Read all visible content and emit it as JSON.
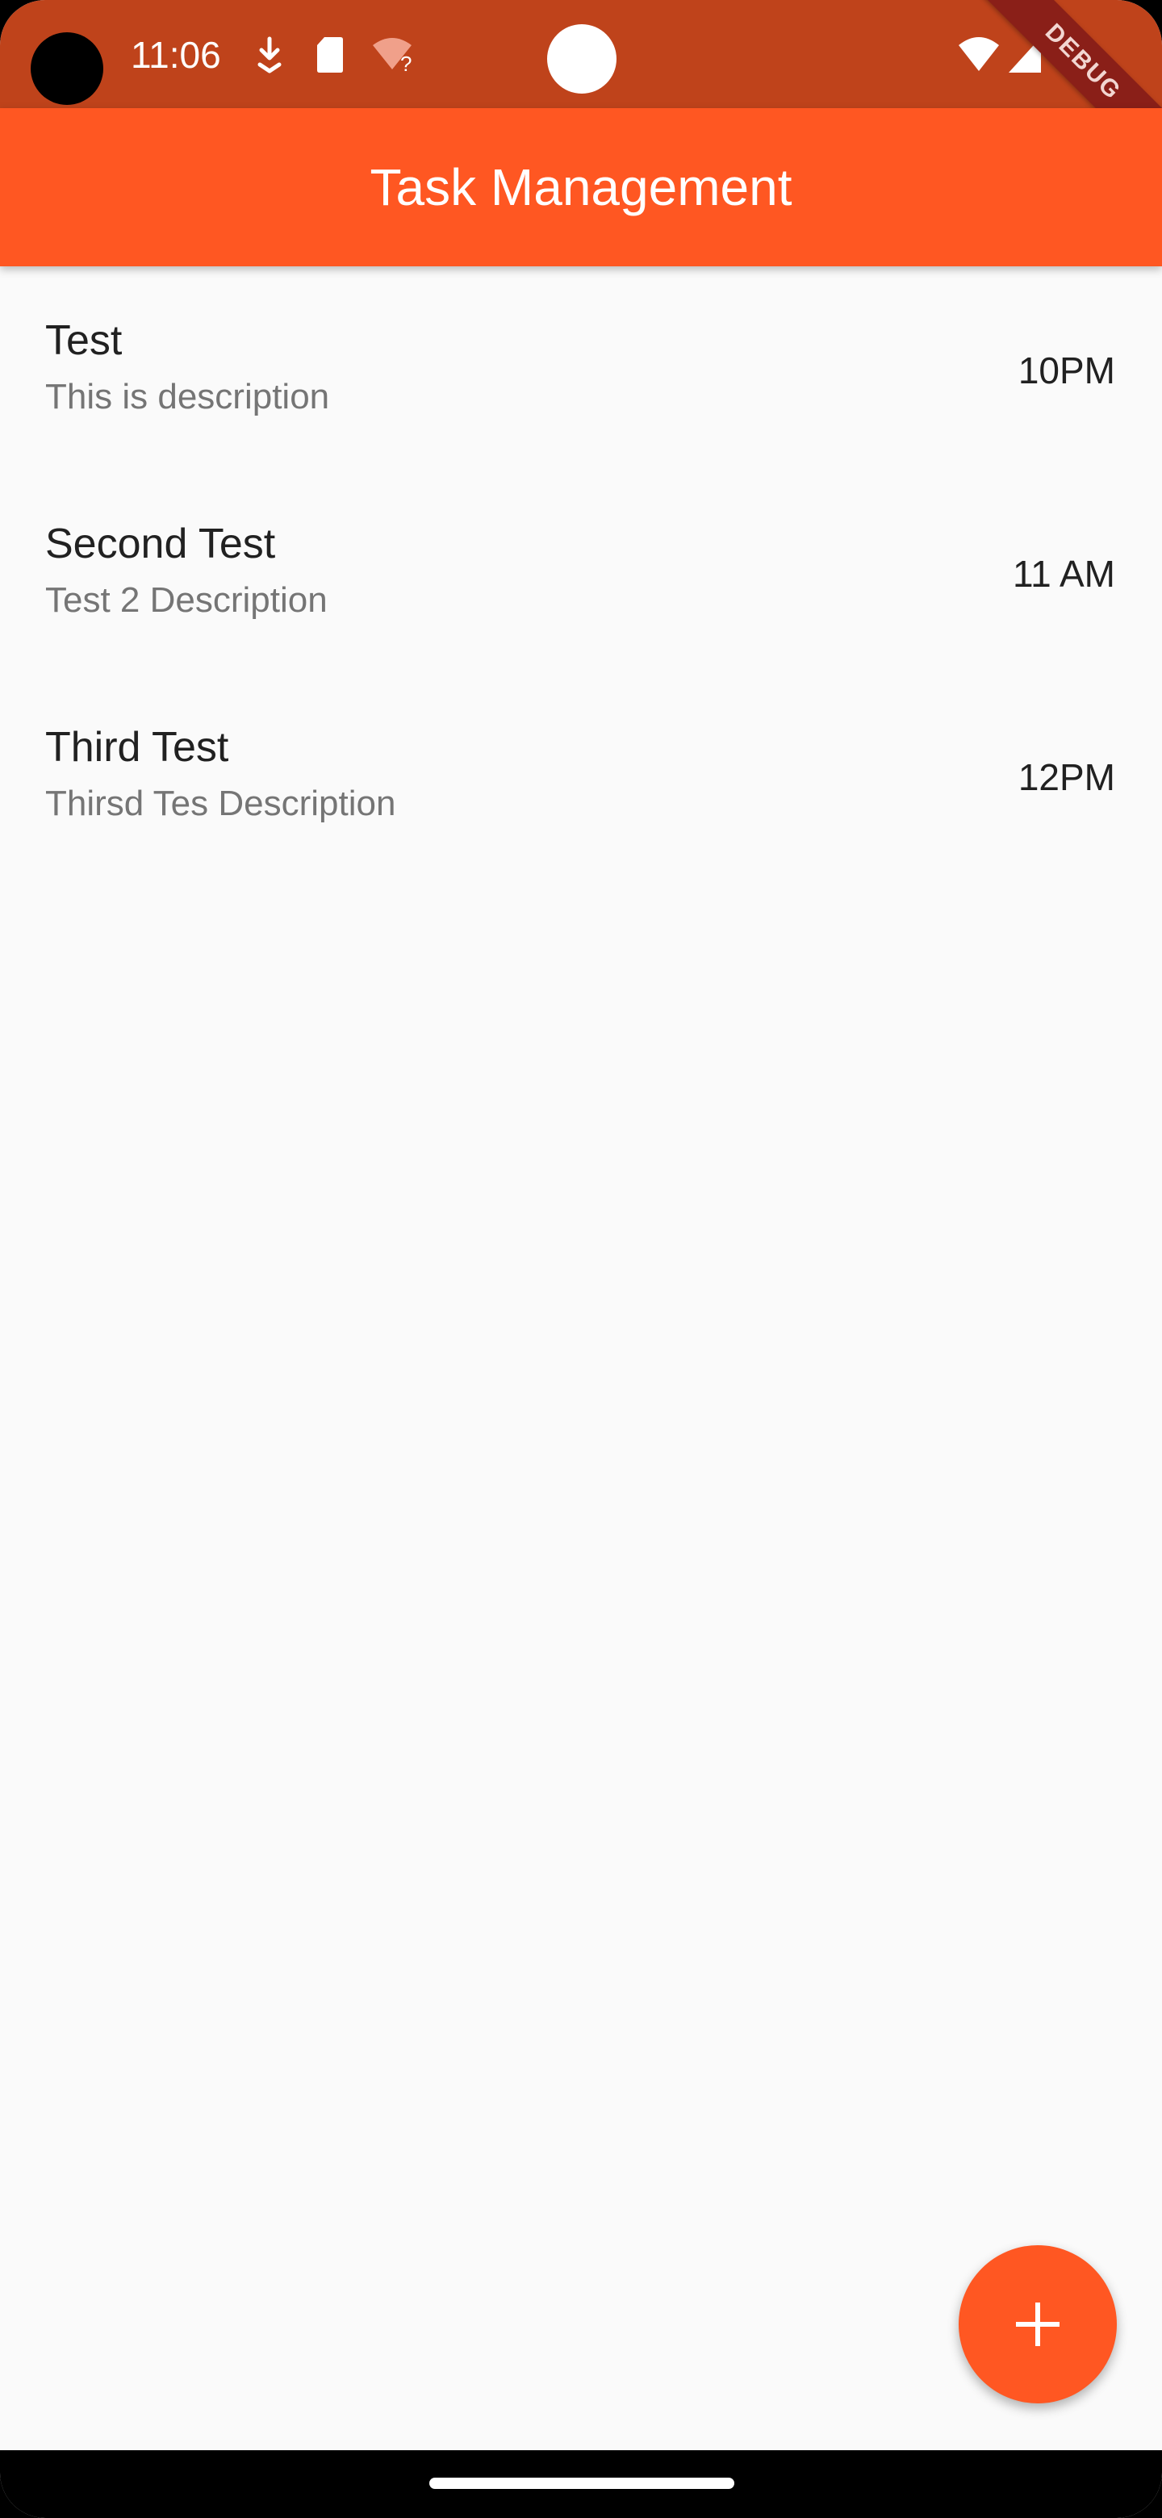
{
  "status_bar": {
    "time": "11:06",
    "icons": [
      "download-icon",
      "sd-card-icon",
      "wifi-unknown-icon",
      "wifi-icon",
      "signal-icon"
    ]
  },
  "debug_banner": {
    "label": "DEBUG"
  },
  "app_bar": {
    "title": "Task Management",
    "color": "#ff5722"
  },
  "tasks": [
    {
      "title": "Test",
      "description": "This is description",
      "time": "10PM"
    },
    {
      "title": "Second Test",
      "description": "Test 2 Description",
      "time": "11 AM"
    },
    {
      "title": "Third Test",
      "description": "Thirsd Tes Description",
      "time": "12PM"
    }
  ],
  "fab": {
    "icon": "plus-icon",
    "color": "#ff5722"
  }
}
